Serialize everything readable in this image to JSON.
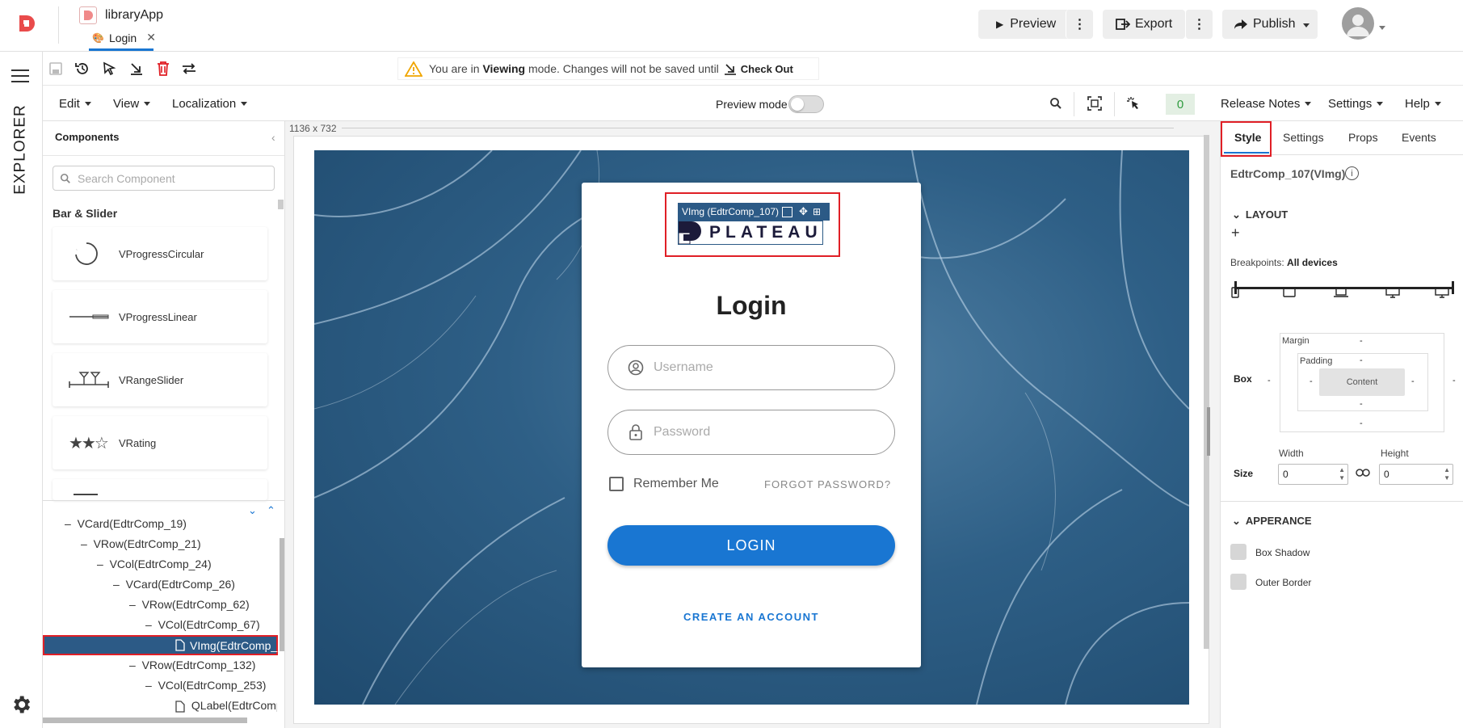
{
  "app": {
    "name": "libraryApp",
    "tab_label": "Login"
  },
  "header": {
    "preview_label": "Preview",
    "export_label": "Export",
    "publish_label": "Publish"
  },
  "toolbar": {
    "banner_prefix": "You are in ",
    "banner_mode": "Viewing",
    "banner_suffix": " mode. Changes will not be saved until",
    "checkout_label": "Check Out"
  },
  "menubar": {
    "edit": "Edit",
    "view": "View",
    "localization": "Localization",
    "preview_mode_label": "Preview mode",
    "count_badge": "0",
    "release_notes": "Release Notes",
    "settings": "Settings",
    "help": "Help"
  },
  "rail": {
    "explorer_label": "EXPLORER"
  },
  "components_panel": {
    "title": "Components",
    "search_placeholder": "Search Component",
    "group_title": "Bar & Slider",
    "items": [
      {
        "label": "VProgressCircular",
        "icon": "progress-circular-icon"
      },
      {
        "label": "VProgressLinear",
        "icon": "progress-linear-icon"
      },
      {
        "label": "VRangeSlider",
        "icon": "range-slider-icon"
      },
      {
        "label": "VRating",
        "icon": "rating-icon"
      }
    ]
  },
  "tree": [
    {
      "label": "VCard(EdtrComp_19)",
      "prefix": "–"
    },
    {
      "label": "VRow(EdtrComp_21)",
      "prefix": "–"
    },
    {
      "label": "VCol(EdtrComp_24)",
      "prefix": "–"
    },
    {
      "label": "VCard(EdtrComp_26)",
      "prefix": "–"
    },
    {
      "label": "VRow(EdtrComp_62)",
      "prefix": "–"
    },
    {
      "label": "VCol(EdtrComp_67)",
      "prefix": "–"
    },
    {
      "label": "VImg(EdtrComp_",
      "prefix": ""
    },
    {
      "label": "VRow(EdtrComp_132)",
      "prefix": "–"
    },
    {
      "label": "VCol(EdtrComp_253)",
      "prefix": "–"
    },
    {
      "label": "QLabel(EdtrComp",
      "prefix": ""
    }
  ],
  "canvas": {
    "size_label": "1136 x 732",
    "selection_label": "VImg (EdtrComp_107)",
    "logo_text": "PLATEAU",
    "login_title": "Login",
    "username_placeholder": "Username",
    "password_placeholder": "Password",
    "remember_label": "Remember Me",
    "forgot_label": "FORGOT PASSWORD?",
    "login_button": "LOGIN",
    "create_account": "CREATE AN ACCOUNT"
  },
  "inspector": {
    "tabs": [
      "Style",
      "Settings",
      "Props",
      "Events"
    ],
    "component_name": "EdtrComp_107(VImg)",
    "layout_section": "LAYOUT",
    "breakpoints_label": "Breakpoints:",
    "breakpoints_value": "All devices",
    "margin_label": "Margin",
    "padding_label": "Padding",
    "content_label": "Content",
    "box_label": "Box",
    "dash": "-",
    "size_label": "Size",
    "width_label": "Width",
    "height_label": "Height",
    "width_value": "0",
    "height_value": "0",
    "appearance_section": "APPERANCE",
    "box_shadow_label": "Box Shadow",
    "outer_border_label": "Outer Border"
  },
  "colors": {
    "brand": "#e94b4b",
    "primary": "#1976d2",
    "highlight": "#e01f26",
    "tree_selected": "#2c5a86"
  }
}
